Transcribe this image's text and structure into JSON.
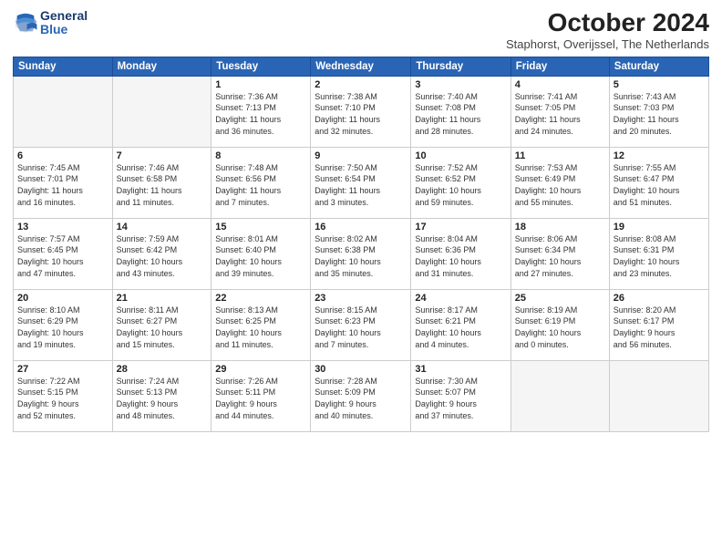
{
  "header": {
    "logo_line1": "General",
    "logo_line2": "Blue",
    "month": "October 2024",
    "location": "Staphorst, Overijssel, The Netherlands"
  },
  "weekdays": [
    "Sunday",
    "Monday",
    "Tuesday",
    "Wednesday",
    "Thursday",
    "Friday",
    "Saturday"
  ],
  "weeks": [
    [
      {
        "day": "",
        "info": ""
      },
      {
        "day": "",
        "info": ""
      },
      {
        "day": "1",
        "info": "Sunrise: 7:36 AM\nSunset: 7:13 PM\nDaylight: 11 hours\nand 36 minutes."
      },
      {
        "day": "2",
        "info": "Sunrise: 7:38 AM\nSunset: 7:10 PM\nDaylight: 11 hours\nand 32 minutes."
      },
      {
        "day": "3",
        "info": "Sunrise: 7:40 AM\nSunset: 7:08 PM\nDaylight: 11 hours\nand 28 minutes."
      },
      {
        "day": "4",
        "info": "Sunrise: 7:41 AM\nSunset: 7:05 PM\nDaylight: 11 hours\nand 24 minutes."
      },
      {
        "day": "5",
        "info": "Sunrise: 7:43 AM\nSunset: 7:03 PM\nDaylight: 11 hours\nand 20 minutes."
      }
    ],
    [
      {
        "day": "6",
        "info": "Sunrise: 7:45 AM\nSunset: 7:01 PM\nDaylight: 11 hours\nand 16 minutes."
      },
      {
        "day": "7",
        "info": "Sunrise: 7:46 AM\nSunset: 6:58 PM\nDaylight: 11 hours\nand 11 minutes."
      },
      {
        "day": "8",
        "info": "Sunrise: 7:48 AM\nSunset: 6:56 PM\nDaylight: 11 hours\nand 7 minutes."
      },
      {
        "day": "9",
        "info": "Sunrise: 7:50 AM\nSunset: 6:54 PM\nDaylight: 11 hours\nand 3 minutes."
      },
      {
        "day": "10",
        "info": "Sunrise: 7:52 AM\nSunset: 6:52 PM\nDaylight: 10 hours\nand 59 minutes."
      },
      {
        "day": "11",
        "info": "Sunrise: 7:53 AM\nSunset: 6:49 PM\nDaylight: 10 hours\nand 55 minutes."
      },
      {
        "day": "12",
        "info": "Sunrise: 7:55 AM\nSunset: 6:47 PM\nDaylight: 10 hours\nand 51 minutes."
      }
    ],
    [
      {
        "day": "13",
        "info": "Sunrise: 7:57 AM\nSunset: 6:45 PM\nDaylight: 10 hours\nand 47 minutes."
      },
      {
        "day": "14",
        "info": "Sunrise: 7:59 AM\nSunset: 6:42 PM\nDaylight: 10 hours\nand 43 minutes."
      },
      {
        "day": "15",
        "info": "Sunrise: 8:01 AM\nSunset: 6:40 PM\nDaylight: 10 hours\nand 39 minutes."
      },
      {
        "day": "16",
        "info": "Sunrise: 8:02 AM\nSunset: 6:38 PM\nDaylight: 10 hours\nand 35 minutes."
      },
      {
        "day": "17",
        "info": "Sunrise: 8:04 AM\nSunset: 6:36 PM\nDaylight: 10 hours\nand 31 minutes."
      },
      {
        "day": "18",
        "info": "Sunrise: 8:06 AM\nSunset: 6:34 PM\nDaylight: 10 hours\nand 27 minutes."
      },
      {
        "day": "19",
        "info": "Sunrise: 8:08 AM\nSunset: 6:31 PM\nDaylight: 10 hours\nand 23 minutes."
      }
    ],
    [
      {
        "day": "20",
        "info": "Sunrise: 8:10 AM\nSunset: 6:29 PM\nDaylight: 10 hours\nand 19 minutes."
      },
      {
        "day": "21",
        "info": "Sunrise: 8:11 AM\nSunset: 6:27 PM\nDaylight: 10 hours\nand 15 minutes."
      },
      {
        "day": "22",
        "info": "Sunrise: 8:13 AM\nSunset: 6:25 PM\nDaylight: 10 hours\nand 11 minutes."
      },
      {
        "day": "23",
        "info": "Sunrise: 8:15 AM\nSunset: 6:23 PM\nDaylight: 10 hours\nand 7 minutes."
      },
      {
        "day": "24",
        "info": "Sunrise: 8:17 AM\nSunset: 6:21 PM\nDaylight: 10 hours\nand 4 minutes."
      },
      {
        "day": "25",
        "info": "Sunrise: 8:19 AM\nSunset: 6:19 PM\nDaylight: 10 hours\nand 0 minutes."
      },
      {
        "day": "26",
        "info": "Sunrise: 8:20 AM\nSunset: 6:17 PM\nDaylight: 9 hours\nand 56 minutes."
      }
    ],
    [
      {
        "day": "27",
        "info": "Sunrise: 7:22 AM\nSunset: 5:15 PM\nDaylight: 9 hours\nand 52 minutes."
      },
      {
        "day": "28",
        "info": "Sunrise: 7:24 AM\nSunset: 5:13 PM\nDaylight: 9 hours\nand 48 minutes."
      },
      {
        "day": "29",
        "info": "Sunrise: 7:26 AM\nSunset: 5:11 PM\nDaylight: 9 hours\nand 44 minutes."
      },
      {
        "day": "30",
        "info": "Sunrise: 7:28 AM\nSunset: 5:09 PM\nDaylight: 9 hours\nand 40 minutes."
      },
      {
        "day": "31",
        "info": "Sunrise: 7:30 AM\nSunset: 5:07 PM\nDaylight: 9 hours\nand 37 minutes."
      },
      {
        "day": "",
        "info": ""
      },
      {
        "day": "",
        "info": ""
      }
    ]
  ]
}
